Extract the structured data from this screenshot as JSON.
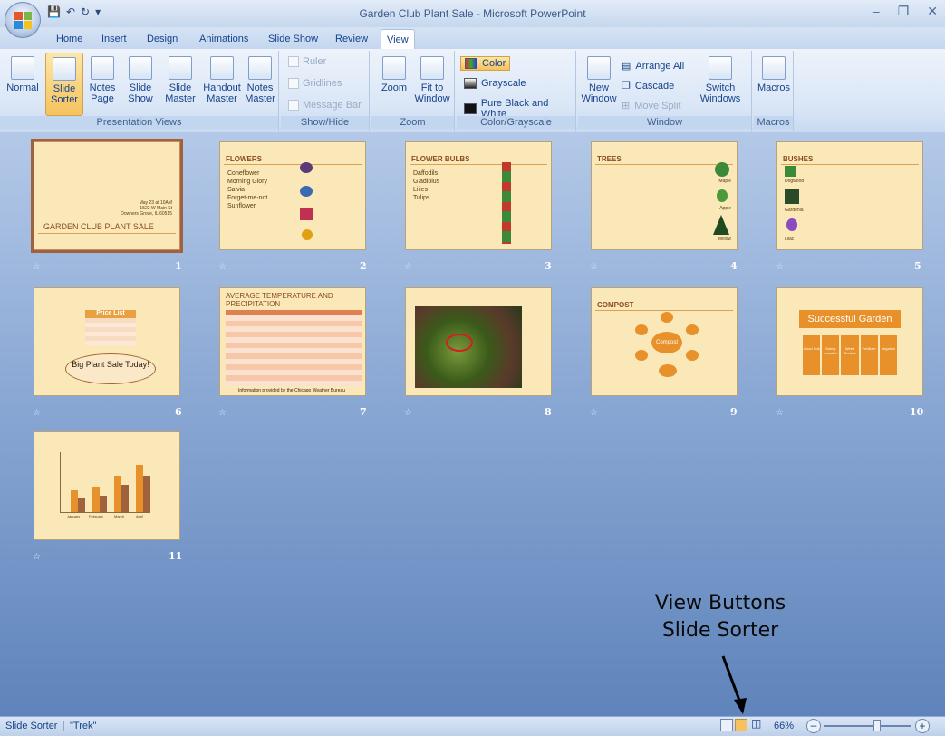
{
  "window": {
    "title": "Garden Club Plant Sale - Microsoft PowerPoint"
  },
  "tabs": [
    "Home",
    "Insert",
    "Design",
    "Animations",
    "Slide Show",
    "Review",
    "View"
  ],
  "ribbon": {
    "presentation_views": {
      "label": "Presentation Views",
      "buttons": [
        "Normal",
        "Slide Sorter",
        "Notes Page",
        "Slide Show",
        "Slide Master",
        "Handout Master",
        "Notes Master"
      ]
    },
    "show_hide": {
      "label": "Show/Hide",
      "items": [
        "Ruler",
        "Gridlines",
        "Message Bar"
      ]
    },
    "zoom": {
      "label": "Zoom",
      "buttons": [
        "Zoom",
        "Fit to Window"
      ]
    },
    "color": {
      "label": "Color/Grayscale",
      "items": [
        "Color",
        "Grayscale",
        "Pure Black and White"
      ]
    },
    "window": {
      "label": "Window",
      "items": [
        "New Window",
        "Arrange All",
        "Cascade",
        "Move Split",
        "Switch Windows"
      ]
    },
    "macros": {
      "label": "Macros",
      "button": "Macros"
    }
  },
  "slides": [
    {
      "n": "1",
      "title": "GARDEN CLUB PLANT SALE",
      "lines": [
        "May 23 at 10AM",
        "1522 W Main St",
        "Downers Grove, IL 60515"
      ]
    },
    {
      "n": "2",
      "title": "FLOWERS",
      "lines": [
        "Coneflower",
        "Morning Glory",
        "Salvia",
        "Forget-me-not",
        "Sunflower"
      ]
    },
    {
      "n": "3",
      "title": "FLOWER BULBS",
      "lines": [
        "Daffodils",
        "Gladiolus",
        "Lilies",
        "Tulips"
      ]
    },
    {
      "n": "4",
      "title": "TREES",
      "lines": [
        "Maple",
        "Apple",
        "Willow"
      ]
    },
    {
      "n": "5",
      "title": "BUSHES",
      "lines": [
        "Dogwood",
        "Gardenia",
        "Lilac"
      ]
    },
    {
      "n": "6",
      "title": "Price List",
      "lines": [
        "Big Plant Sale Today!"
      ]
    },
    {
      "n": "7",
      "title": "AVERAGE TEMPERATURE AND PRECIPITATION",
      "lines": [
        "Information provided by the Chicago Weather Bureau"
      ]
    },
    {
      "n": "8",
      "title": "",
      "lines": []
    },
    {
      "n": "9",
      "title": "COMPOST",
      "lines": [
        "Compost"
      ]
    },
    {
      "n": "10",
      "title": "Successful Garden",
      "lines": [
        "Good Soil",
        "Sunny Location",
        "Weed Control",
        "Fertilizer",
        "Irrigation"
      ]
    },
    {
      "n": "11",
      "title": "",
      "lines": [
        "January",
        "February",
        "March",
        "April"
      ]
    }
  ],
  "status": {
    "view": "Slide Sorter",
    "theme": "\"Trek\"",
    "zoom": "66%"
  },
  "callout": {
    "line1": "View Buttons",
    "line2": "Slide Sorter"
  }
}
